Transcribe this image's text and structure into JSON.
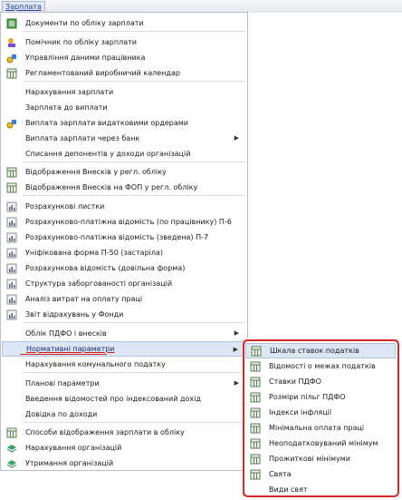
{
  "menubar": {
    "label": "Зарплата"
  },
  "colors": {
    "accent": "#2a3e8c",
    "highlight_frame": "#d22b2b",
    "selected_bg": "#dce6f5"
  },
  "menu": {
    "items": [
      {
        "label": "Документи по обліку зарплати",
        "icon": "document-list-icon"
      },
      {
        "label": "Помічник по обліку зарплати",
        "icon": "assistant-icon"
      },
      {
        "label": "Управління даними працівника",
        "icon": "employee-key-icon"
      },
      {
        "label": "Регламентований виробничий календар",
        "icon": "calendar-icon"
      },
      {
        "label": "Нарахування зарплати",
        "icon": ""
      },
      {
        "label": "Зарплата до виплати",
        "icon": ""
      },
      {
        "label": "Виплата зарплати видатковими ордерами",
        "icon": "payment-key-icon"
      },
      {
        "label": "Виплата зарплати через банк",
        "icon": "",
        "submenu": true
      },
      {
        "label": "Списання депонентів у доходи організацій",
        "icon": ""
      },
      {
        "label": "Відображення Внесків у регл. обліку",
        "icon": "table-icon"
      },
      {
        "label": "Відображення Внесків на ФОП у регл. обліку",
        "icon": "table-icon"
      },
      {
        "label": "Розрахункові листки",
        "icon": "report-icon"
      },
      {
        "label": "Розрахунково-платіжна відомість (по працівнику) П-6",
        "icon": "report-icon"
      },
      {
        "label": "Розрахунково-платіжна відомість (зведена) П-7",
        "icon": "report-icon"
      },
      {
        "label": "Уніфікована форма П-50 (застаріла)",
        "icon": "report-icon"
      },
      {
        "label": "Розрахункова відомість (довільна форма)",
        "icon": "report-icon"
      },
      {
        "label": "Структура заборгованості організацій",
        "icon": "report-icon"
      },
      {
        "label": "Аналіз витрат на оплату праці",
        "icon": "report-icon"
      },
      {
        "label": "Звіт відрахувань у Фонди",
        "icon": "report-icon"
      },
      {
        "label": "Облік ПДФО і внесків",
        "icon": "",
        "submenu": true
      },
      {
        "label": "Нормативні параметри",
        "icon": "",
        "submenu": true,
        "selected": true
      },
      {
        "label": "Нарахування комунального податку",
        "icon": ""
      },
      {
        "label": "Планові параметри",
        "icon": "",
        "submenu": true
      },
      {
        "label": "Введення відомостей про індексований дохід",
        "icon": ""
      },
      {
        "label": "Довідка по доходи",
        "icon": ""
      },
      {
        "label": "Способи відображення зарплати в обліку",
        "icon": "table-icon"
      },
      {
        "label": "Нарахування організацій",
        "icon": "stack-icon"
      },
      {
        "label": "Утримання організацій",
        "icon": "stack-icon"
      }
    ]
  },
  "submenu": {
    "items": [
      {
        "label": "Шкала ставок податків",
        "icon": "table-icon",
        "active": true
      },
      {
        "label": "Відомості о межах податків",
        "icon": "table-icon"
      },
      {
        "label": "Ставки ПДФО",
        "icon": "table-icon"
      },
      {
        "label": "Розміри пільг ПДФО",
        "icon": "table-icon"
      },
      {
        "label": "Індекси інфляції",
        "icon": "table-icon"
      },
      {
        "label": "Мінімальна оплата праці",
        "icon": "table-icon"
      },
      {
        "label": "Неоподатковуваний мінімум",
        "icon": "table-icon"
      },
      {
        "label": "Прожиткові мінімуми",
        "icon": "table-icon"
      },
      {
        "label": "Свята",
        "icon": "table-icon"
      },
      {
        "label": "Види свят",
        "icon": ""
      }
    ]
  }
}
